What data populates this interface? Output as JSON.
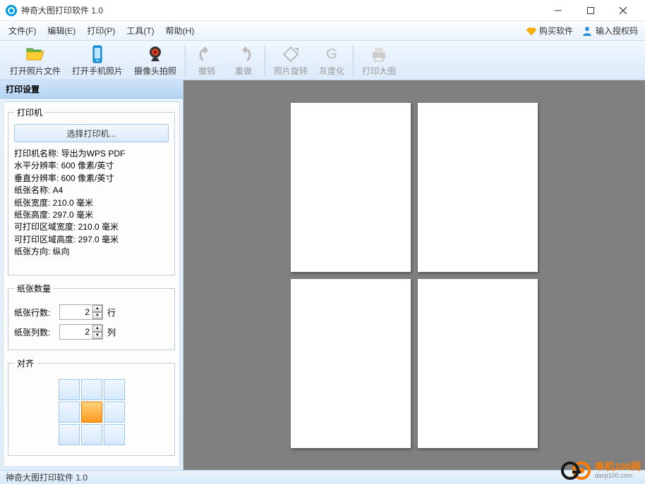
{
  "app": {
    "title": "神奇大图打印软件 1.0"
  },
  "menubar": {
    "file": "文件(F)",
    "edit": "编辑(E)",
    "print": "打印(P)",
    "tools": "工具(T)",
    "help": "帮助(H)",
    "buy": "购买软件",
    "license": "输入授权码"
  },
  "toolbar": {
    "open_photo": "打开照片文件",
    "open_phone": "打开手机照片",
    "camera": "摄像头拍照",
    "undo": "撤销",
    "redo": "重做",
    "rotate": "照片旋转",
    "grayscale": "灰度化",
    "print_big": "打印大图"
  },
  "sidebar": {
    "header": "打印设置",
    "printer_legend": "打印机",
    "select_printer": "选择打印机...",
    "info": {
      "l1": "打印机名称: 导出为WPS PDF",
      "l2": "水平分辨率: 600 像素/英寸",
      "l3": "垂直分辨率: 600 像素/英寸",
      "l4": "纸张名称: A4",
      "l5": "纸张宽度: 210.0 毫米",
      "l6": "纸张高度: 297.0 毫米",
      "l7": "可打印区域宽度: 210.0 毫米",
      "l8": "可打印区域高度: 297.0 毫米",
      "l9": "纸张方向: 纵向"
    },
    "paper_count_legend": "纸张数量",
    "rows_label": "纸张行数:",
    "rows_value": "2",
    "rows_unit": "行",
    "cols_label": "纸张列数:",
    "cols_value": "2",
    "cols_unit": "列",
    "align_legend": "对齐"
  },
  "status": {
    "text": "神奇大图打印软件 1.0"
  },
  "watermark": {
    "brand": "单机100网",
    "url": "danji100.com"
  }
}
